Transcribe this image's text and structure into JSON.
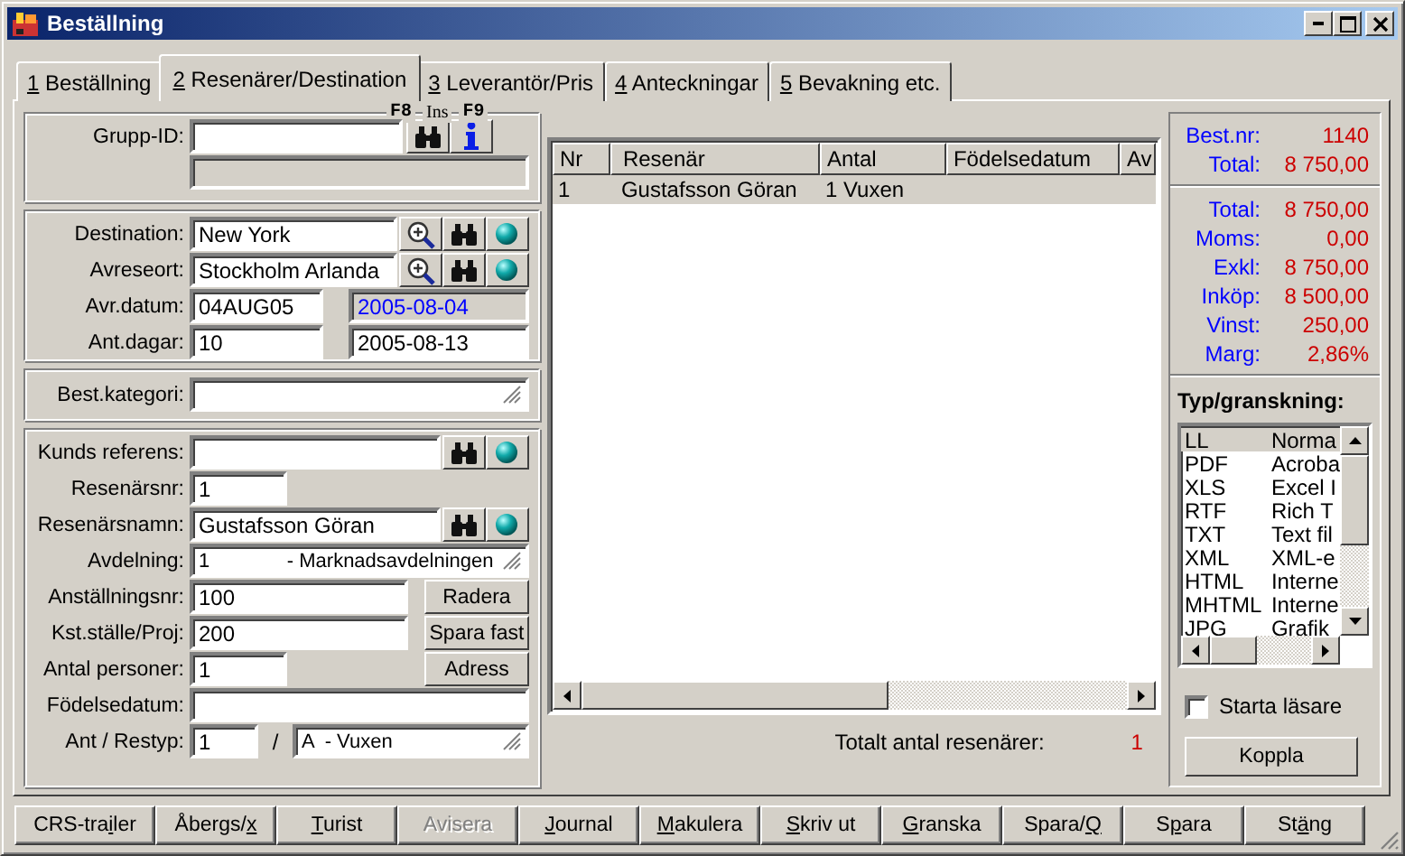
{
  "window": {
    "title": "Beställning"
  },
  "tabs": [
    {
      "key": "1",
      "post": " Beställning",
      "selected": false
    },
    {
      "key": "2",
      "post": " Resenärer/Destination",
      "selected": true
    },
    {
      "key": "3",
      "post": " Leverantör/Pris",
      "selected": false
    },
    {
      "key": "4",
      "post": " Anteckningar",
      "selected": false
    },
    {
      "key": "5",
      "post": " Bevakning etc.",
      "selected": false
    }
  ],
  "sections": [
    {
      "hotkeys": [
        "F8",
        "Ins",
        "F9"
      ],
      "rows": [
        {
          "label": "Grupp-ID:",
          "items": [
            {
              "kind": "id-field"
            },
            {
              "kind": "find-button"
            },
            {
              "kind": "info-button"
            }
          ]
        },
        {
          "items": [
            {
              "kind": "readonly"
            }
          ]
        }
      ]
    },
    {
      "rows": [
        {
          "label": "Destination:",
          "items": [
            {
              "kind": "field",
              "value": "New York"
            },
            {
              "kind": "zoom-button"
            },
            {
              "kind": "find-button"
            },
            {
              "kind": "go-button"
            }
          ]
        },
        {
          "label": "Avreseort:",
          "items": [
            {
              "kind": "field",
              "value": "Stockholm Arlanda"
            },
            {
              "kind": "zoom-button"
            },
            {
              "kind": "find-button"
            },
            {
              "kind": "go-button"
            }
          ]
        },
        {
          "label": "Avr.datum:",
          "items": [
            {
              "kind": "date-field",
              "value": "04AUG05"
            },
            {
              "kind": "readonly",
              "value": "2005-08-04"
            }
          ]
        },
        {
          "label": "Ant.dagar:",
          "items": [
            {
              "kind": "date-field",
              "value": "10"
            },
            {
              "kind": "field",
              "value": "2005-08-13"
            }
          ]
        }
      ]
    },
    {
      "rows": [
        {
          "label": "Best.kategori:",
          "items": [
            {
              "kind": "combo"
            }
          ]
        }
      ]
    },
    {
      "rows": [
        {
          "label": "Kunds referens:",
          "items": [
            {
              "kind": "field"
            },
            {
              "kind": "find-button"
            },
            {
              "kind": "go-button"
            }
          ]
        },
        {
          "label": "Resenärsnr:",
          "items": [
            {
              "kind": "short-field",
              "value": "1"
            }
          ]
        },
        {
          "label": "Resenärsnamn:",
          "items": [
            {
              "kind": "field",
              "value": "Gustafsson Göran"
            },
            {
              "kind": "find-button"
            },
            {
              "kind": "go-button"
            }
          ]
        },
        {
          "label": "Avdelning:",
          "items": [
            {
              "kind": "combo",
              "value": "1              - Marknadsavdelningen"
            }
          ]
        },
        {
          "label": "Anställningsnr:",
          "items": [
            {
              "kind": "field",
              "value": "100"
            },
            {
              "kind": "button",
              "label": "Radera"
            }
          ]
        },
        {
          "label": "Kst.ställe/Proj:",
          "items": [
            {
              "kind": "field",
              "value": "200"
            },
            {
              "kind": "button",
              "label": "Spara fast"
            }
          ]
        },
        {
          "label": "Antal personer:",
          "items": [
            {
              "kind": "short-field",
              "value": "1"
            },
            {
              "kind": "spacer"
            },
            {
              "kind": "button",
              "label": "Adress"
            }
          ]
        },
        {
          "label": "Födelsedatum:",
          "items": [
            {
              "kind": "field"
            }
          ]
        },
        {
          "label": "Ant / Restyp:",
          "items": [
            {
              "kind": "tiny-field",
              "value": "1"
            },
            {
              "kind": "slash",
              "label": "/"
            },
            {
              "kind": "combo",
              "value": "A  - Vuxen"
            }
          ]
        }
      ]
    }
  ],
  "grid": {
    "columns": [
      "Nr",
      "Resenär",
      "Antal",
      "Födelsedatum",
      "Av"
    ],
    "rows": [
      {
        "cells": [
          "1",
          "Gustafsson Göran",
          "1 Vuxen",
          null,
          null
        ],
        "selected": true
      }
    ],
    "footer": {
      "label": "Totalt antal resenärer:",
      "value": "1"
    }
  },
  "summary": [
    {
      "rows": [
        {
          "label": "Best.nr:",
          "value": "1140"
        },
        {
          "label": "Total:",
          "value": "8 750,00"
        }
      ]
    },
    {
      "rows": [
        {
          "label": "Total:",
          "value": "8 750,00"
        },
        {
          "label": "Moms:",
          "value": "0,00"
        },
        {
          "label": "Exkl:",
          "value": "8 750,00"
        },
        {
          "label": "Inköp:",
          "value": "8 500,00"
        },
        {
          "label": "Vinst:",
          "value": "250,00"
        },
        {
          "label": "Marg:",
          "value": "2,86%"
        }
      ]
    }
  ],
  "preview": {
    "title": "Typ/granskning:",
    "items": [
      {
        "code": "LL",
        "desc": "Norma",
        "selected": true
      },
      {
        "code": "PDF",
        "desc": "Acroba",
        "selected": false
      },
      {
        "code": "XLS",
        "desc": "Excel I",
        "selected": false
      },
      {
        "code": "RTF",
        "desc": "Rich T",
        "selected": false
      },
      {
        "code": "TXT",
        "desc": "Text fil",
        "selected": false
      },
      {
        "code": "XML",
        "desc": "XML-e",
        "selected": false
      },
      {
        "code": "HTML",
        "desc": "Interne",
        "selected": false
      },
      {
        "code": "MHTML",
        "desc": "Interne",
        "selected": false
      },
      {
        "code": "JPG",
        "desc": "Grafik",
        "selected": false
      }
    ],
    "checkbox": {
      "label": "Starta läsare",
      "checked": false
    },
    "button": "Koppla"
  },
  "buttons": [
    {
      "pre": "CRS-tra",
      "key": "i",
      "post": "ler",
      "disabled": false
    },
    {
      "pre": "Åbergs/",
      "key": "x",
      "disabled": false
    },
    {
      "key": "T",
      "post": "urist",
      "disabled": false
    },
    {
      "pre": "Avisera",
      "disabled": true
    },
    {
      "key": "J",
      "post": "ournal",
      "disabled": false
    },
    {
      "key": "M",
      "post": "akulera",
      "disabled": false
    },
    {
      "key": "S",
      "post": "kriv ut",
      "disabled": false
    },
    {
      "key": "G",
      "post": "ranska",
      "disabled": false
    },
    {
      "pre": "Spara/",
      "key": "Q",
      "disabled": false
    },
    {
      "pre": "S",
      "key": "p",
      "post": "ara",
      "disabled": false
    },
    {
      "pre": "St",
      "key": "ä",
      "post": "ng",
      "disabled": false
    }
  ]
}
